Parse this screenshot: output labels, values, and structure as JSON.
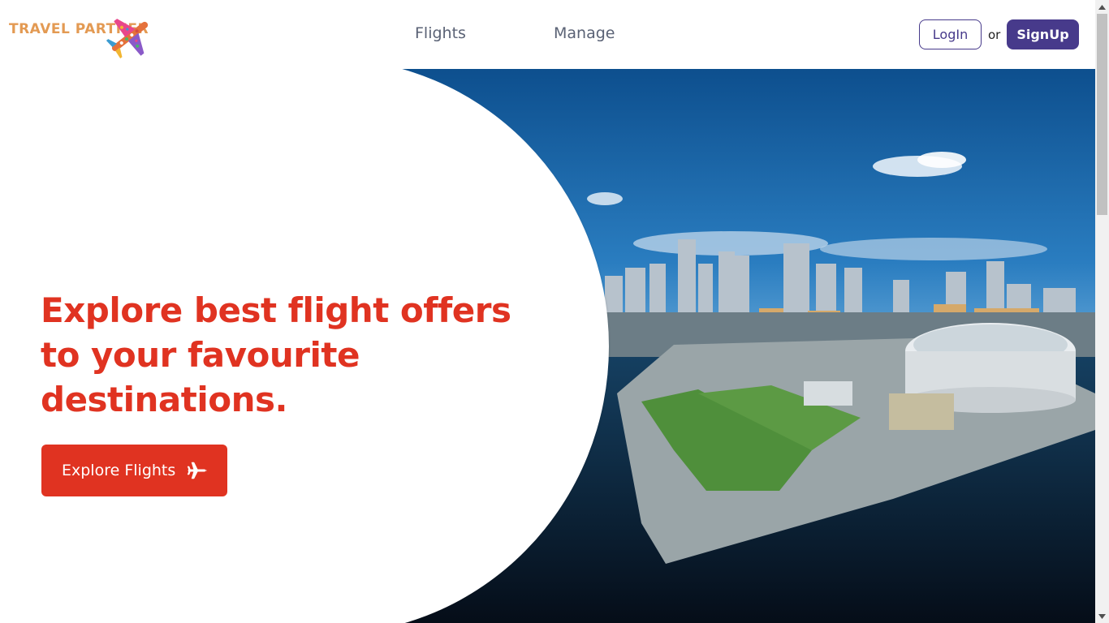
{
  "brand": {
    "name": "TRAVEL PARTNER",
    "color": "#e39a53"
  },
  "nav": {
    "flights_label": "Flights",
    "manage_label": "Manage"
  },
  "auth": {
    "login_label": "LogIn",
    "separator": "or",
    "signup_label": "SignUp",
    "accent_color": "#473a8b"
  },
  "hero": {
    "heading": "Explore best flight offers to your favourite destinations.",
    "cta_label": "Explore Flights",
    "cta_icon": "airplane-icon",
    "accent_color": "#e03321"
  }
}
